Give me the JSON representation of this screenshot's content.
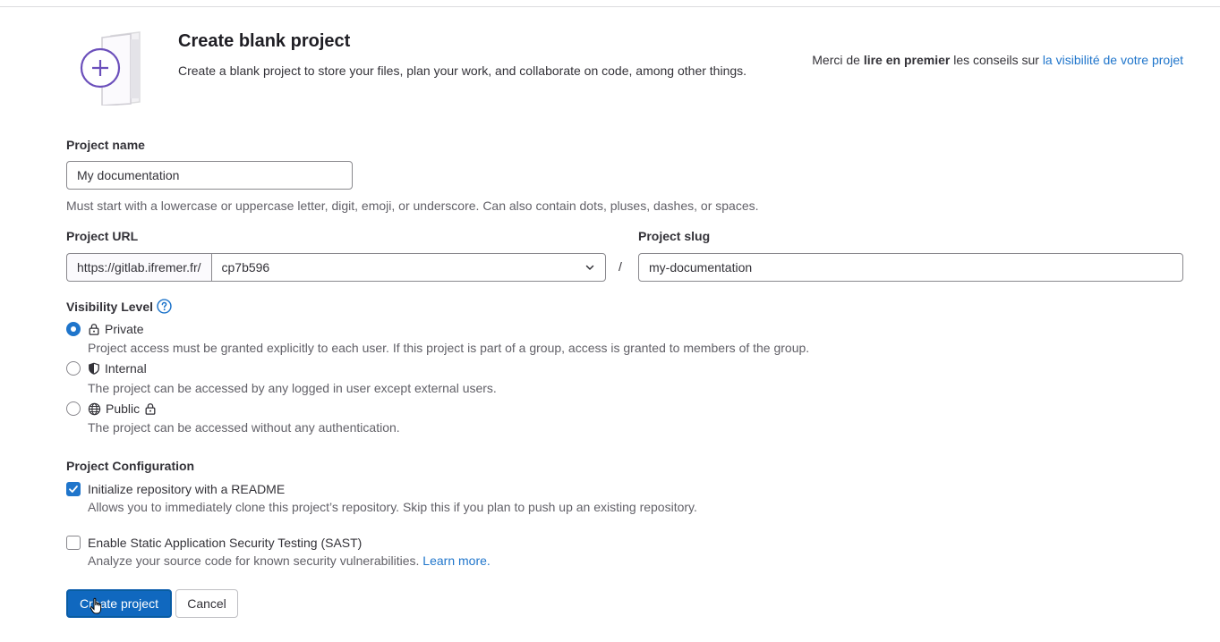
{
  "header": {
    "title": "Create blank project",
    "description": "Create a blank project to store your files, plan your work, and collaborate on code, among other things.",
    "notice_prefix": "Merci de ",
    "notice_bold": "lire en premier",
    "notice_middle": " les conseils sur ",
    "notice_link": "la visibilité de votre projet"
  },
  "project_name": {
    "label": "Project name",
    "value": "My documentation",
    "help": "Must start with a lowercase or uppercase letter, digit, emoji, or underscore. Can also contain dots, pluses, dashes, or spaces."
  },
  "project_url": {
    "label": "Project URL",
    "prefix": "https://gitlab.ifremer.fr/",
    "namespace": "cp7b596",
    "separator": "/"
  },
  "project_slug": {
    "label": "Project slug",
    "value": "my-documentation"
  },
  "visibility": {
    "label": "Visibility Level",
    "options": [
      {
        "label": "Private",
        "help": "Project access must be granted explicitly to each user. If this project is part of a group, access is granted to members of the group.",
        "icon": "lock-icon",
        "selected": true
      },
      {
        "label": "Internal",
        "help": "The project can be accessed by any logged in user except external users.",
        "icon": "shield-icon",
        "selected": false
      },
      {
        "label": "Public",
        "help": "The project can be accessed without any authentication.",
        "icon": "globe-icon",
        "selected": false
      }
    ]
  },
  "configuration": {
    "label": "Project Configuration",
    "readme": {
      "label": "Initialize repository with a README",
      "help": "Allows you to immediately clone this project’s repository. Skip this if you plan to push up an existing repository.",
      "checked": true
    },
    "sast": {
      "label": "Enable Static Application Security Testing (SAST)",
      "help": "Analyze your source code for known security vulnerabilities.",
      "link": "Learn more.",
      "checked": false
    }
  },
  "actions": {
    "create": "Create project",
    "cancel": "Cancel"
  },
  "colors": {
    "primary": "#1068bf",
    "link": "#1f75cb",
    "illustration_purple": "#6b4fbb"
  }
}
